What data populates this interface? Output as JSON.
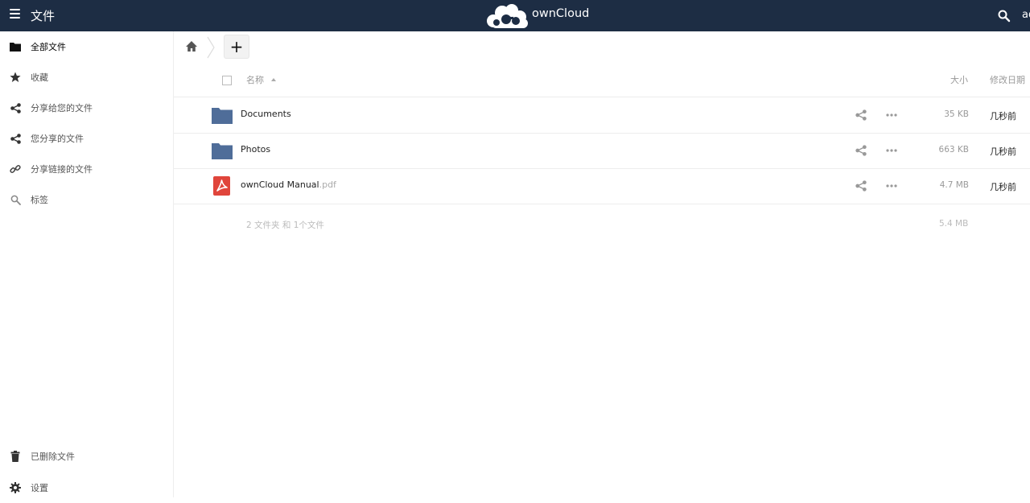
{
  "header": {
    "app_title": "文件",
    "brand": "ownCloud",
    "user": "ad"
  },
  "sidebar": {
    "items": [
      {
        "label": "全部文件",
        "icon": "folder-icon"
      },
      {
        "label": "收藏",
        "icon": "star-icon"
      },
      {
        "label": "分享给您的文件",
        "icon": "share-icon"
      },
      {
        "label": "您分享的文件",
        "icon": "share-icon"
      },
      {
        "label": "分享链接的文件",
        "icon": "link-icon"
      },
      {
        "label": "标签",
        "icon": "search-icon"
      }
    ],
    "bottom": [
      {
        "label": "已删除文件",
        "icon": "trash-icon"
      },
      {
        "label": "设置",
        "icon": "gear-icon"
      }
    ]
  },
  "toolbar": {
    "new_label": "+"
  },
  "table": {
    "columns": {
      "name": "名称",
      "size": "大小",
      "modified": "修改日期"
    },
    "rows": [
      {
        "name": "Documents",
        "ext": "",
        "type": "folder",
        "size": "35 KB",
        "modified": "几秒前"
      },
      {
        "name": "Photos",
        "ext": "",
        "type": "folder",
        "size": "663 KB",
        "modified": "几秒前"
      },
      {
        "name": "ownCloud Manual",
        "ext": ".pdf",
        "type": "pdf",
        "size": "4.7 MB",
        "modified": "几秒前"
      }
    ],
    "summary": {
      "text": "2 文件夹 和 1个文件",
      "size": "5.4 MB"
    }
  },
  "colors": {
    "header_bg": "#1d2d44",
    "folder": "#4f6d99",
    "pdf": "#e0453b"
  }
}
